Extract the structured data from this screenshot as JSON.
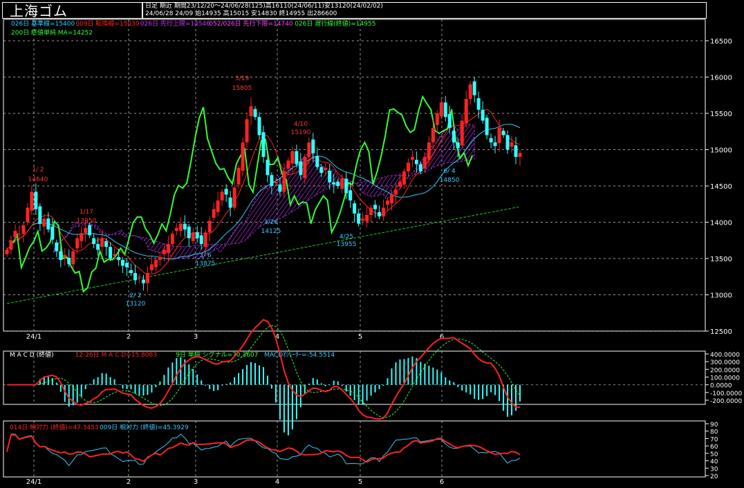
{
  "header": {
    "title": "上海ゴム",
    "line1": "日足  期近  期間23/12/20～24/06/28(125)高16110(24/06/11)安13120(24/02/02)",
    "line2": "24/06/28 24/09 始14935 高15015 安14830 終14955 出286600"
  },
  "main_legend": {
    "row1": [
      {
        "text": "026日 基準線=15400",
        "color": "#33ccff"
      },
      {
        "text": "009日 転換線=15030",
        "color": "#ff2222"
      },
      {
        "text": "026日 先行上限=14546",
        "color": "#cc33ff"
      },
      {
        "text": "052/026日 先行下限=14740",
        "color": "#ff44ff"
      },
      {
        "text": "026日 遅行線(終値)=14955",
        "color": "#33ff33"
      }
    ],
    "row2": [
      {
        "text": "200日 終値単純 MA=14252",
        "color": "#33ff33"
      }
    ]
  },
  "price_axis": [
    "16500",
    "16000",
    "15500",
    "15000",
    "14500",
    "14000",
    "13500",
    "13000",
    "12500"
  ],
  "x_axis": [
    "24/1",
    "2",
    "3",
    "4",
    "5",
    "6"
  ],
  "annotations": [
    {
      "date": "1/ 2",
      "price": "14640",
      "color": "#ff3333"
    },
    {
      "date": "1/17",
      "price": "13950",
      "color": "#ff3333"
    },
    {
      "date": "2/ 2",
      "price": "13120",
      "color": "#33ccff"
    },
    {
      "date": "3/ 6",
      "price": "13875",
      "color": "#33ccff"
    },
    {
      "date": "3/19",
      "price": "15805",
      "color": "#ff3333"
    },
    {
      "date": "3/26",
      "price": "14125",
      "color": "#33ccff"
    },
    {
      "date": "4/10",
      "price": "15190",
      "color": "#ff3333"
    },
    {
      "date": "4/25",
      "price": "13955",
      "color": "#33ccff"
    },
    {
      "date": "6/ 4",
      "price": "14850",
      "color": "#33ccff"
    }
  ],
  "macd_legend": [
    {
      "text": "M A C D  (終値)",
      "color": "#ffffff"
    },
    {
      "text": "12-26日  M A C D=15.8083",
      "color": "#ff2222"
    },
    {
      "text": "9日  単純  シグナル=70.3607",
      "color": "#33ff33"
    },
    {
      "text": "MACDｵｼﾚｰﾀｰ=-54.5514",
      "color": "#33ccff"
    }
  ],
  "macd_axis": [
    "400.0000",
    "300.0000",
    "200.0000",
    "100.0000",
    "0.0000",
    "-100.0000",
    "-200.0000"
  ],
  "rs_legend": [
    {
      "text": "014日 相対力 (終値)=47.3453",
      "color": "#ff2222"
    },
    {
      "text": "009日 相対力 (終値)=45.3929",
      "color": "#33ccff"
    }
  ],
  "rs_axis": [
    "90",
    "80",
    "70",
    "60",
    "50",
    "40",
    "30",
    "20"
  ],
  "colors": {
    "background": "#000000",
    "up_candle": "#ff2222",
    "down_candle": "#33ffff",
    "kijun": "#33ccff",
    "tenkan": "#ff2222",
    "chikou": "#33ff33",
    "ma200": "#22cc22",
    "cloud": "#cc33ff",
    "grid": "#dddddd"
  },
  "chart_data": [
    {
      "type": "candlestick",
      "title": "上海ゴム",
      "x_ticks": [
        "24/1",
        "2",
        "3",
        "4",
        "5",
        "6"
      ],
      "ylim": [
        12500,
        16700
      ],
      "series": [
        {
          "name": "026日 基準線",
          "last": 15400
        },
        {
          "name": "009日 転換線",
          "last": 15030
        },
        {
          "name": "026日 先行上限",
          "last": 14546
        },
        {
          "name": "052/026日 先行下限",
          "last": 14740
        },
        {
          "name": "026日 遅行線(終値)",
          "last": 14955
        },
        {
          "name": "200日 終値単純 MA",
          "last": 14252
        }
      ],
      "closes": [
        13620,
        13750,
        13880,
        13840,
        13960,
        14200,
        14420,
        14180,
        13980,
        14050,
        13900,
        13760,
        13600,
        13480,
        13550,
        13420,
        13600,
        13780,
        13850,
        13920,
        13820,
        13700,
        13620,
        13780,
        13660,
        13500,
        13560,
        13480,
        13400,
        13380,
        13300,
        13200,
        13250,
        13160,
        13300,
        13420,
        13480,
        13520,
        13620,
        13700,
        13840,
        13920,
        13980,
        13900,
        13780,
        13860,
        13780,
        13700,
        13860,
        14020,
        14180,
        14300,
        14420,
        14380,
        14200,
        14480,
        14750,
        15100,
        15420,
        15600,
        15450,
        15200,
        14900,
        14650,
        14500,
        14560,
        14420,
        14700,
        14850,
        14980,
        14800,
        14650,
        14900,
        15100,
        14950,
        14760,
        14680,
        14750,
        14550,
        14520,
        14500,
        14600,
        14400,
        14300,
        14120,
        13980,
        14050,
        14100,
        14200,
        14180,
        14080,
        14200,
        14300,
        14380,
        14450,
        14560,
        14700,
        14820,
        14900,
        14800,
        14700,
        14900,
        15100,
        15300,
        15500,
        15650,
        15450,
        15300,
        15100,
        15020,
        15400,
        15700,
        15900,
        15750,
        15550,
        15400,
        15200,
        15100,
        15050,
        15300,
        15200,
        15000,
        15100,
        14900,
        14955
      ],
      "sma200": {
        "start": 12880,
        "end": 14210
      }
    },
    {
      "type": "line",
      "title": "M A C D  (終値)",
      "ylim": [
        -200,
        400
      ],
      "series": [
        {
          "name": "12-26日  M A C D",
          "last": 15.8083
        },
        {
          "name": "9日  単純  シグナル",
          "last": 70.3607
        },
        {
          "name": "MACDｵｼﾚｰﾀｰ",
          "last": -54.5514
        }
      ]
    },
    {
      "type": "line",
      "title": "相対力",
      "ylim": [
        20,
        90
      ],
      "series": [
        {
          "name": "014日 相対力 (終値)",
          "last": 47.3453
        },
        {
          "name": "009日 相対力 (終値)",
          "last": 45.3929
        }
      ]
    }
  ]
}
